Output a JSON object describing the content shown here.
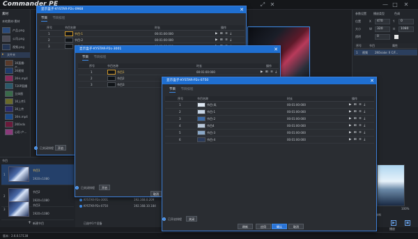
{
  "app": {
    "title": "Commander PE",
    "version": "版本：2.6.0.17138"
  },
  "left": {
    "header": "素材",
    "subheader": "本地素材-素材",
    "items": [
      {
        "label": "产品.png"
      },
      {
        "label": "公司.png"
      },
      {
        "label": "视频.png"
      }
    ],
    "folder": "文件夹",
    "thumbs": [
      "1K直播-产...",
      "2K视频",
      "2K-k.mp4",
      "720P直播",
      "立体图",
      "1K上传1",
      "1K上传",
      "1K-k.mp4",
      "2K6ndx",
      "心形-产..."
    ]
  },
  "bottom": {
    "header": "节目",
    "programs": [
      {
        "index": "1",
        "name": "节目1",
        "size": "1920×1080"
      },
      {
        "index": "2",
        "name": "节目2",
        "size": "1920×1080"
      },
      {
        "index": "3",
        "name": "节目3",
        "size": "1920×1080"
      }
    ],
    "add_label": "新建节目"
  },
  "right": {
    "tabs": [
      "参数设置",
      "播放类型",
      "色调"
    ],
    "x_label": "X",
    "x_value": "470",
    "y_label": "Y",
    "y_value": "0",
    "size_label": "大小",
    "w_label": "W",
    "w_value": "320",
    "h_label": "H",
    "h_value": "1080",
    "opacity_label": "透明",
    "opacity_value": "0",
    "list_header": [
      "序号",
      "节目",
      "属性"
    ],
    "row": {
      "index": "1",
      "type": "视频",
      "name": "2K6nake: II C/F..."
    },
    "zoom": "100%",
    "time": "0:25",
    "playback_label": "播放",
    "hdmi": "HDMI"
  },
  "devices": {
    "rows": [
      {
        "name": "KYSTAR-P2s-3001",
        "ip": "192.168.0.209"
      },
      {
        "name": "KYSTAR-P2s-0750",
        "ip": "192.168.10.184"
      }
    ],
    "selected_count": "已选中1个设备"
  },
  "dialog1": {
    "title": "显示盒子-KYSTAR-P2s-0968",
    "tabs": [
      "节目",
      "节目排程"
    ],
    "headers": [
      "序号",
      "节目名称",
      "时长",
      "操作"
    ],
    "rows": [
      {
        "index": "1",
        "name": "节目-1",
        "duration": "00:01:00:000",
        "ops": "▶ ⊞ ≡ ⤓"
      },
      {
        "index": "2",
        "name": "节目-2",
        "duration": "00:01:00:000",
        "ops": "▶ ⊞ ≡ ⤓"
      },
      {
        "index": "3",
        "name": "节目-3",
        "duration": "00:01:00:000",
        "ops": "▶ ⊞ ≡ ⤓"
      }
    ],
    "schedule_label": "已关闭排程",
    "schedule_btn": "开启"
  },
  "dialog2": {
    "title": "显示盒子-KYSTAR-P2s-3001",
    "tabs": [
      "节目",
      "节目排程"
    ],
    "headers": [
      "序号",
      "节目名称",
      "时长",
      "操作"
    ],
    "rows": [
      {
        "index": "1",
        "name": "节目1",
        "duration": "00:01:00:000",
        "ops": "▶ ⊞ ≡ ⤓"
      },
      {
        "index": "2",
        "name": "节目2",
        "duration": "00:01:00:000",
        "ops": "▶ ⊞ ≡ ⤓"
      },
      {
        "index": "3",
        "name": "节目3",
        "duration": "00:01:00:000",
        "ops": "▶ ⊞ ≡ ⤓"
      }
    ],
    "schedule_label": "已关闭排程",
    "schedule_btn": "开启",
    "cancel_btn": "取消"
  },
  "dialog3": {
    "title": "显示盒子-KYSTAR-P2s-0750",
    "tabs": [
      "节目",
      "节目排程"
    ],
    "headers": [
      "序号",
      "节目名称",
      "时长",
      "操作"
    ],
    "rows": [
      {
        "index": "1",
        "name": "节目-风",
        "duration": "00:01:00:000",
        "ops": "▶ ⊞ ≡ ⤓"
      },
      {
        "index": "2",
        "name": "节目-1",
        "duration": "00:01:00:000",
        "ops": "▶ ⊞ ≡ ⤓"
      },
      {
        "index": "3",
        "name": "节目-2",
        "duration": "00:01:00:000",
        "ops": "▶ ⊞ ≡ ⤓"
      },
      {
        "index": "4",
        "name": "节目4",
        "duration": "00:01:00:000",
        "ops": "▶ ⊞ ≡ ⤓"
      },
      {
        "index": "5",
        "name": "节目-3",
        "duration": "00:01:00:000",
        "ops": "▶ ⊞ ≡ ⤓"
      },
      {
        "index": "6",
        "name": "节目-4",
        "duration": "00:01:00:000",
        "ops": "▶ ⊞ ≡ ⤓"
      }
    ],
    "schedule_label": "已开启排程",
    "schedule_btn": "关闭",
    "buttons": {
      "refresh": "刷新",
      "apply": "应用",
      "ok": "确认",
      "cancel": "取消"
    }
  }
}
